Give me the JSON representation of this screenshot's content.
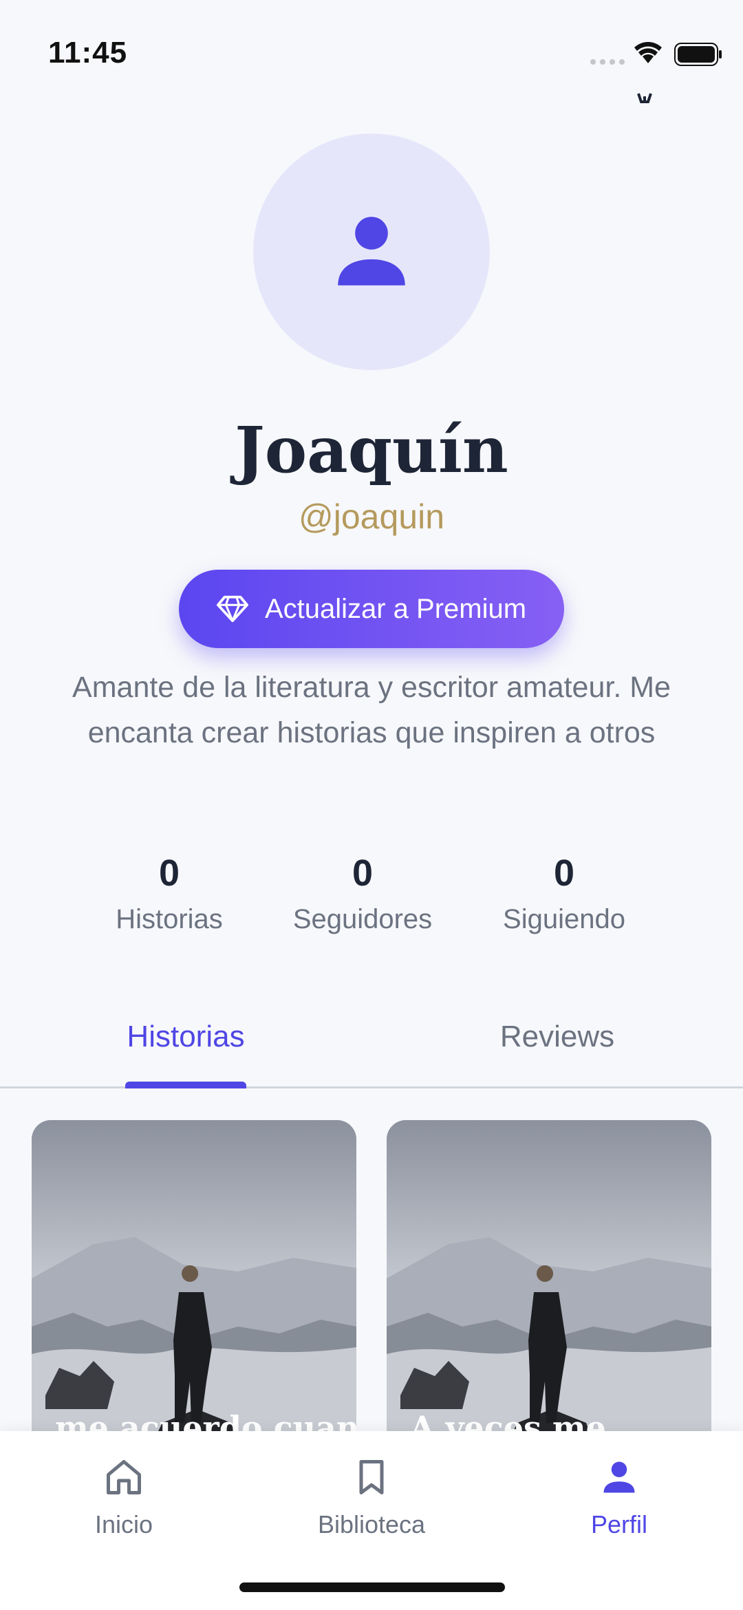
{
  "status_bar": {
    "time": "11:45"
  },
  "profile": {
    "name": "Joaquín",
    "handle": "@joaquin",
    "premium_button_label": "Actualizar a Premium",
    "bio": "Amante de la literatura y escritor amateur. Me encanta crear historias que inspiren a otros"
  },
  "stats": [
    {
      "value": "0",
      "label": "Historias"
    },
    {
      "value": "0",
      "label": "Seguidores"
    },
    {
      "value": "0",
      "label": "Siguiendo"
    }
  ],
  "tabs": [
    {
      "label": "Historias",
      "active": true
    },
    {
      "label": "Reviews",
      "active": false
    }
  ],
  "stories": [
    {
      "title": "me acuerdo cuan"
    },
    {
      "title": "A veces me"
    }
  ],
  "bottom_nav": [
    {
      "label": "Inicio",
      "icon": "home-icon",
      "active": false
    },
    {
      "label": "Biblioteca",
      "icon": "bookmark-icon",
      "active": false
    },
    {
      "label": "Perfil",
      "icon": "person-icon",
      "active": true
    }
  ],
  "colors": {
    "accent": "#4f46e5",
    "avatar_bg": "#e6e6fb",
    "handle": "#b59a5d",
    "premium_gradient_start": "#5b46f0",
    "premium_gradient_end": "#8760f4"
  }
}
